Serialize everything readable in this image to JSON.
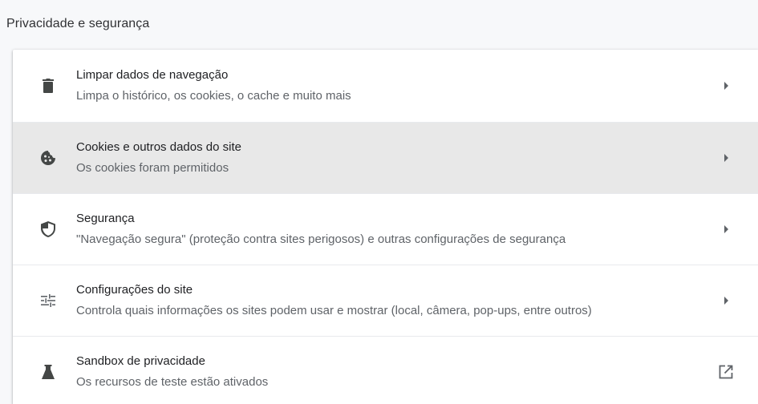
{
  "section": {
    "title": "Privacidade e segurança"
  },
  "rows": [
    {
      "label": "Limpar dados de navegação",
      "sub": "Limpa o histórico, os cookies, o cache e muito mais",
      "icon": "trash-icon",
      "action": "arrow-right-icon"
    },
    {
      "label": "Cookies e outros dados do site",
      "sub": "Os cookies foram permitidos",
      "icon": "cookie-icon",
      "action": "arrow-right-icon",
      "hovered": true
    },
    {
      "label": "Segurança",
      "sub": "\"Navegação segura\" (proteção contra sites perigosos) e outras configurações de segurança",
      "icon": "shield-icon",
      "action": "arrow-right-icon"
    },
    {
      "label": "Configurações do site",
      "sub": "Controla quais informações os sites podem usar e mostrar (local, câmera, pop-ups, entre outros)",
      "icon": "tune-icon",
      "action": "arrow-right-icon"
    },
    {
      "label": "Sandbox de privacidade",
      "sub": "Os recursos de teste estão ativados",
      "icon": "flask-icon",
      "action": "open-in-new-icon"
    }
  ],
  "colors": {
    "page_background": "#f7f8fa",
    "card_background": "#ffffff",
    "hover_row": "#e8e8e8",
    "primary_text": "#202124",
    "secondary_text": "#5f6368",
    "icon": "#5f6368"
  }
}
